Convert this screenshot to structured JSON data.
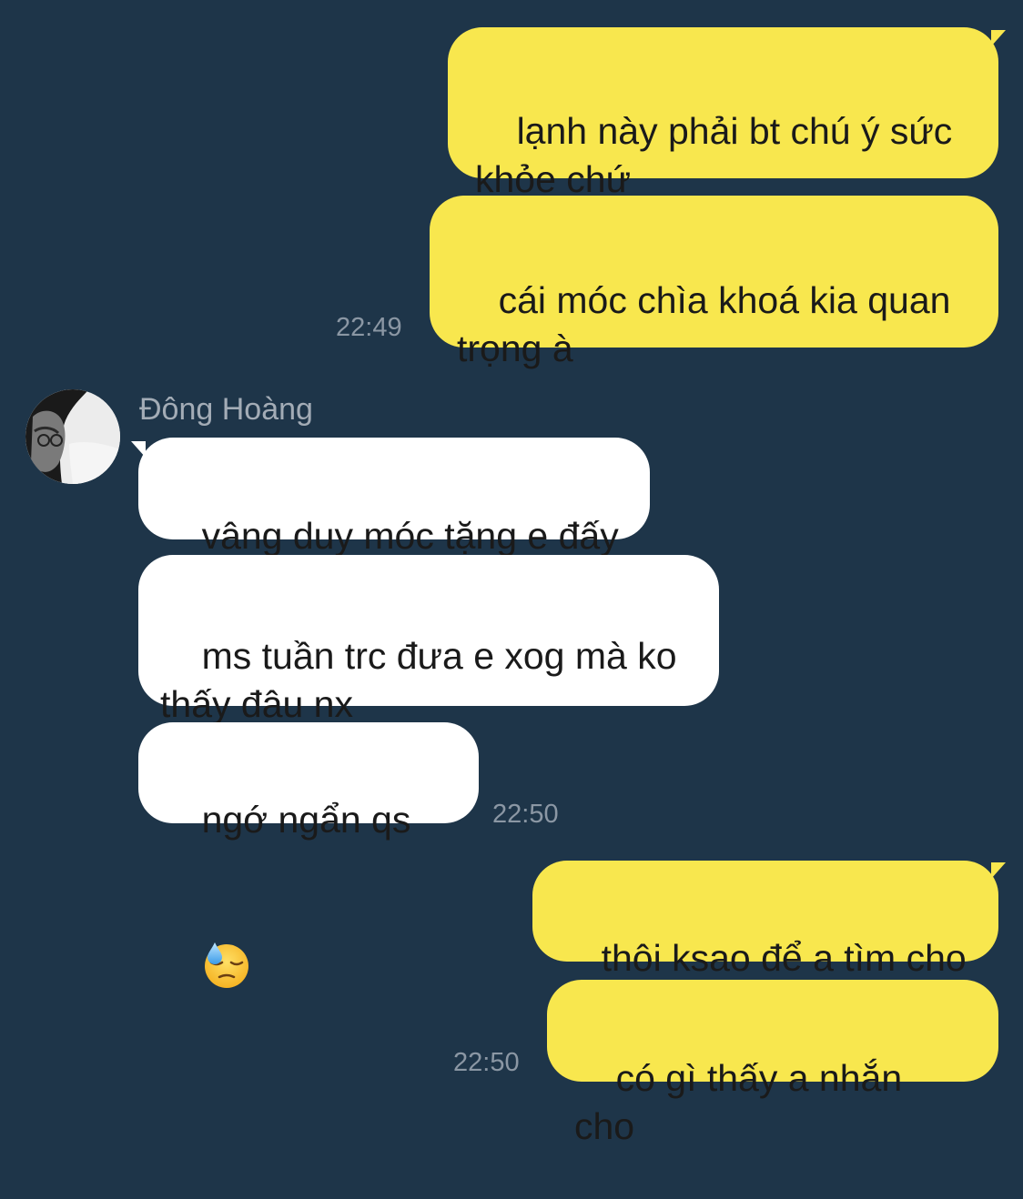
{
  "contact": {
    "name": "Đông Hoàng"
  },
  "messages": {
    "m1": "lạnh này phải bt chú ý sức khỏe chứ",
    "m2": "cái móc chìa khoá kia quan trọng à",
    "m3": "vâng duy móc tặng e đấy",
    "m4": "ms tuần trc đưa e xog mà ko thấy đâu nx",
    "m5": "ngớ ngẩn qs",
    "m6": "thôi ksao để a tìm cho",
    "m7": "có gì thấy a nhắn cho"
  },
  "timestamps": {
    "t1": "22:49",
    "t2": "22:50",
    "t3": "22:50"
  },
  "icons": {
    "emoji": "downcast-face-with-sweat-emoji"
  },
  "colors": {
    "background": "#1e3549",
    "outgoing_bubble": "#f8e74e",
    "incoming_bubble": "#ffffff",
    "timestamp": "#8b97a4",
    "sender_name": "#a3acb6"
  }
}
